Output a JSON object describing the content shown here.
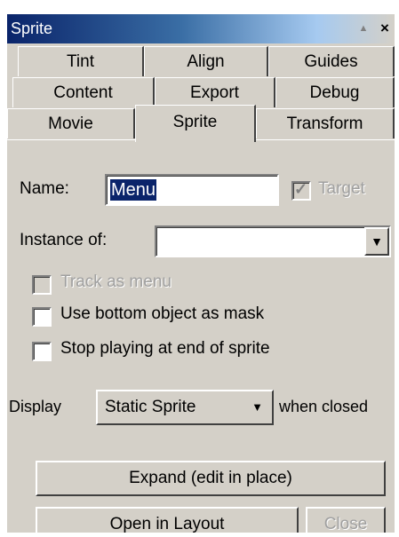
{
  "window": {
    "title": "Sprite",
    "collapse_icon": "triangle-up-icon",
    "close_label": "×"
  },
  "tabs": {
    "row1": [
      "Tint",
      "Align",
      "Guides"
    ],
    "row2": [
      "Content",
      "Export",
      "Debug"
    ],
    "row3": [
      "Movie",
      "Sprite",
      "Transform"
    ],
    "active": "Sprite"
  },
  "form": {
    "name_label": "Name:",
    "name_value": "Menu",
    "target_label": "Target",
    "target_checked": true,
    "instance_label": "Instance of:",
    "instance_value": "",
    "track_menu_label": "Track as menu",
    "use_bottom_label": "Use bottom object as mask",
    "stop_playing_label": "Stop playing at end of sprite",
    "display_label": "Display",
    "display_value": "Static Sprite",
    "when_closed_label": "when closed"
  },
  "buttons": {
    "expand": "Expand (edit in place)",
    "open_layout": "Open in Layout",
    "close": "Close"
  },
  "colors": {
    "face": "#d4d0c8",
    "title_start": "#0a246a",
    "title_end": "#a6caf0",
    "disabled_text": "#a0a0a0"
  }
}
